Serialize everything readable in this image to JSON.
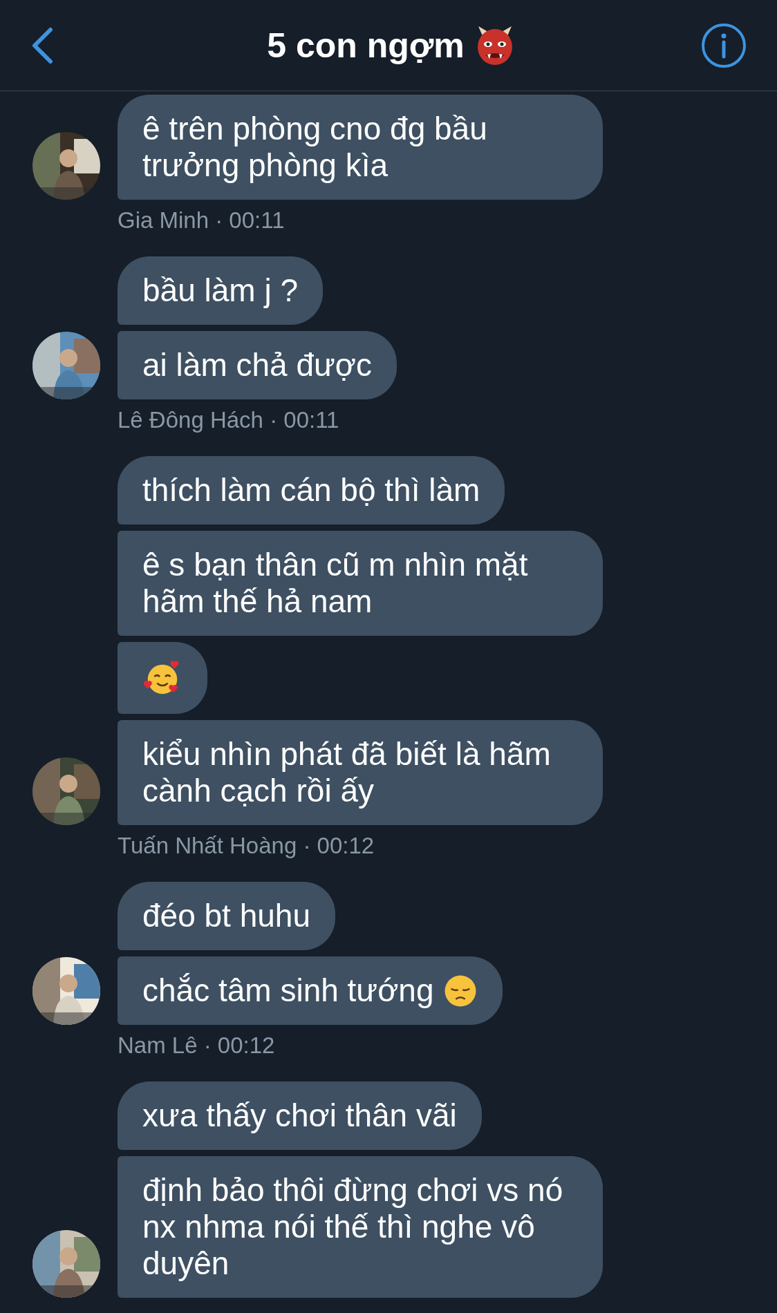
{
  "header": {
    "title": "5 con ngợm",
    "emoji": {
      "kind": "ogre"
    }
  },
  "groups": [
    {
      "avatar": {
        "kind": "picture"
      },
      "meta": "Gia Minh · 00:11",
      "messages": [
        {
          "kind": "text",
          "text": "ê trên phòng cno đg bầu trưởng phòng kìa"
        }
      ]
    },
    {
      "avatar": {
        "kind": "picture"
      },
      "meta": "Lê Đông Hách · 00:11",
      "messages": [
        {
          "kind": "text",
          "text": "bầu làm j ?"
        },
        {
          "kind": "text",
          "text": "ai làm chả được"
        }
      ]
    },
    {
      "avatar": {
        "kind": "picture"
      },
      "meta": "Tuấn Nhất Hoàng · 00:12",
      "messages": [
        {
          "kind": "text",
          "text": "thích làm cán bộ thì làm"
        },
        {
          "kind": "text",
          "text": "ê s bạn thân cũ m nhìn mặt hãm thế hả nam"
        },
        {
          "kind": "emoji",
          "icon": {
            "kind": "smiling-hearts"
          }
        },
        {
          "kind": "text",
          "text": "kiểu nhìn phát đã biết là hãm cành cạch rồi ấy"
        }
      ]
    },
    {
      "avatar": {
        "kind": "picture"
      },
      "meta": "Nam Lê · 00:12",
      "messages": [
        {
          "kind": "text",
          "text": "đéo bt huhu"
        },
        {
          "kind": "text",
          "text": "chắc tâm sinh tướng",
          "trailing_icon": {
            "kind": "sad"
          }
        }
      ]
    },
    {
      "avatar": {
        "kind": "picture"
      },
      "messages": [
        {
          "kind": "text",
          "text": "xưa thấy chơi thân vãi"
        },
        {
          "kind": "text",
          "text": "định bảo thôi đừng chơi vs nó nx nhma nói thế thì nghe vô duyên"
        }
      ]
    }
  ]
}
